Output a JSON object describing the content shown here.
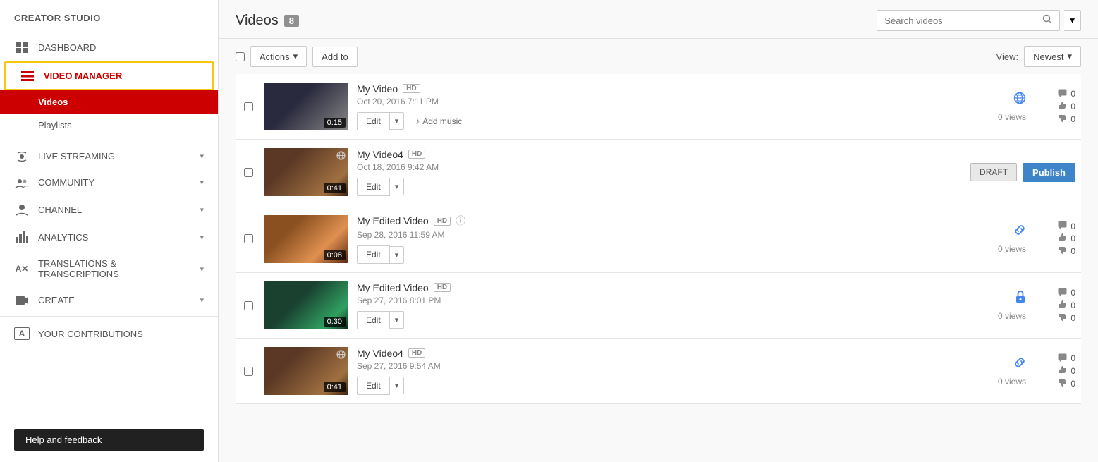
{
  "sidebar": {
    "brand": "CREATOR STUDIO",
    "items": [
      {
        "id": "dashboard",
        "label": "DASHBOARD",
        "icon": "▦",
        "hasChevron": false
      },
      {
        "id": "video-manager",
        "label": "VIDEO MANAGER",
        "icon": "☰",
        "hasChevron": false,
        "active": true,
        "children": [
          {
            "id": "videos",
            "label": "Videos",
            "active": true
          },
          {
            "id": "playlists",
            "label": "Playlists",
            "active": false
          }
        ]
      },
      {
        "id": "live-streaming",
        "label": "LIVE STREAMING",
        "icon": "◉",
        "hasChevron": true
      },
      {
        "id": "community",
        "label": "COMMUNITY",
        "icon": "👥",
        "hasChevron": true
      },
      {
        "id": "channel",
        "label": "CHANNEL",
        "icon": "👤",
        "hasChevron": true
      },
      {
        "id": "analytics",
        "label": "ANALYTICS",
        "icon": "📊",
        "hasChevron": true
      },
      {
        "id": "translations",
        "label": "TRANSLATIONS & TRANSCRIPTIONS",
        "icon": "✕A",
        "hasChevron": true
      },
      {
        "id": "create",
        "label": "CREATE",
        "icon": "🎬",
        "hasChevron": true
      },
      {
        "id": "your-contributions",
        "label": "YOUR CONTRIBUTIONS",
        "icon": "A✕",
        "hasChevron": false
      }
    ],
    "help_button": "Help and feedback"
  },
  "header": {
    "title": "Videos",
    "count": "8",
    "search_placeholder": "Search videos"
  },
  "toolbar": {
    "actions_label": "Actions",
    "add_to_label": "Add to",
    "view_label": "View:",
    "newest_label": "Newest"
  },
  "videos": [
    {
      "id": 1,
      "title": "My Video",
      "hd": true,
      "date": "Oct 20, 2016 7:11 PM",
      "duration": "0:15",
      "thumb_class": "thumb-1",
      "status_icon": "globe",
      "status_unicode": "🌐",
      "views": "0 views",
      "comments": "0",
      "likes": "0",
      "dislikes": "0",
      "has_add_music": true,
      "is_draft": false,
      "info_icon": false
    },
    {
      "id": 2,
      "title": "My Video4",
      "hd": true,
      "date": "Oct 18, 2016 9:42 AM",
      "duration": "0:41",
      "thumb_class": "thumb-2",
      "status_icon": "none",
      "status_unicode": "",
      "views": "",
      "comments": "",
      "likes": "",
      "dislikes": "",
      "has_add_music": false,
      "is_draft": true,
      "info_icon": false
    },
    {
      "id": 3,
      "title": "My Edited Video",
      "hd": true,
      "date": "Sep 28, 2016 11:59 AM",
      "duration": "0:08",
      "thumb_class": "thumb-3",
      "status_icon": "link",
      "status_unicode": "🔗",
      "views": "0 views",
      "comments": "0",
      "likes": "0",
      "dislikes": "0",
      "has_add_music": false,
      "is_draft": false,
      "info_icon": true
    },
    {
      "id": 4,
      "title": "My Edited Video",
      "hd": true,
      "date": "Sep 27, 2016 8:01 PM",
      "duration": "0:30",
      "thumb_class": "thumb-4",
      "status_icon": "lock",
      "status_unicode": "🔒",
      "views": "0 views",
      "comments": "0",
      "likes": "0",
      "dislikes": "0",
      "has_add_music": false,
      "is_draft": false,
      "info_icon": false
    },
    {
      "id": 5,
      "title": "My Video4",
      "hd": true,
      "date": "Sep 27, 2016 9:54 AM",
      "duration": "0:41",
      "thumb_class": "thumb-5",
      "status_icon": "link",
      "status_unicode": "🔗",
      "views": "0 views",
      "comments": "0",
      "likes": "0",
      "dislikes": "0",
      "has_add_music": false,
      "is_draft": false,
      "info_icon": false
    }
  ],
  "labels": {
    "edit": "Edit",
    "add_music": "Add music",
    "publish": "Publish",
    "draft": "DRAFT",
    "views_zero": "0 views"
  }
}
